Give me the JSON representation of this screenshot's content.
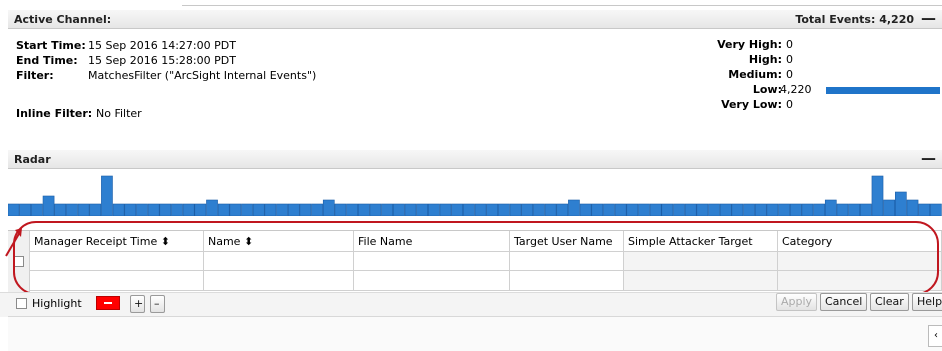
{
  "active_channel": {
    "title": "Active Channel:",
    "total_events": "Total Events: 4,220",
    "collapse": "—",
    "start_time_label": "Start Time:",
    "start_time": "15 Sep 2016 14:27:00 PDT",
    "end_time_label": "End Time:",
    "end_time": "15 Sep 2016 15:28:00 PDT",
    "filter_label": "Filter:",
    "filter": "MatchesFilter (\"ArcSight Internal Events\")",
    "inline_filter_label": "Inline Filter:",
    "inline_filter": "No Filter",
    "priorities": [
      {
        "label": "Very High:",
        "value": "0",
        "fraction": 0
      },
      {
        "label": "High:",
        "value": "0",
        "fraction": 0
      },
      {
        "label": "Medium:",
        "value": "0",
        "fraction": 0
      },
      {
        "label": "Low:",
        "value": "4,220",
        "fraction": 1
      },
      {
        "label": "Very Low:",
        "value": "0",
        "fraction": 0
      }
    ],
    "bar_color": "#1f74c9"
  },
  "radar": {
    "title": "Radar",
    "collapse": "—",
    "bar_color": "#2e7fd0",
    "bars": [
      3,
      3,
      3,
      5,
      3,
      3,
      3,
      3,
      10,
      3,
      3,
      3,
      3,
      3,
      3,
      3,
      3,
      4,
      3,
      3,
      3,
      3,
      3,
      3,
      3,
      3,
      3,
      4,
      3,
      3,
      3,
      3,
      3,
      3,
      3,
      3,
      3,
      3,
      3,
      3,
      3,
      3,
      3,
      3,
      3,
      3,
      3,
      3,
      4,
      3,
      3,
      3,
      3,
      3,
      3,
      3,
      3,
      3,
      3,
      3,
      3,
      3,
      3,
      3,
      3,
      3,
      3,
      3,
      3,
      3,
      4,
      3,
      3,
      3,
      10,
      4,
      6,
      4,
      3,
      3
    ]
  },
  "grid": {
    "columns": [
      {
        "label": "Manager Receipt Time ⬍"
      },
      {
        "label": "Name ⬍"
      },
      {
        "label": "File Name"
      },
      {
        "label": "Target User Name"
      },
      {
        "label": "Simple Attacker Target"
      },
      {
        "label": "Category"
      }
    ]
  },
  "footer": {
    "highlight": "Highlight",
    "plus": "+",
    "minus": "–",
    "apply": "Apply",
    "cancel": "Cancel",
    "clear": "Clear",
    "help": "Help"
  },
  "annotation_color": "#c0171f"
}
